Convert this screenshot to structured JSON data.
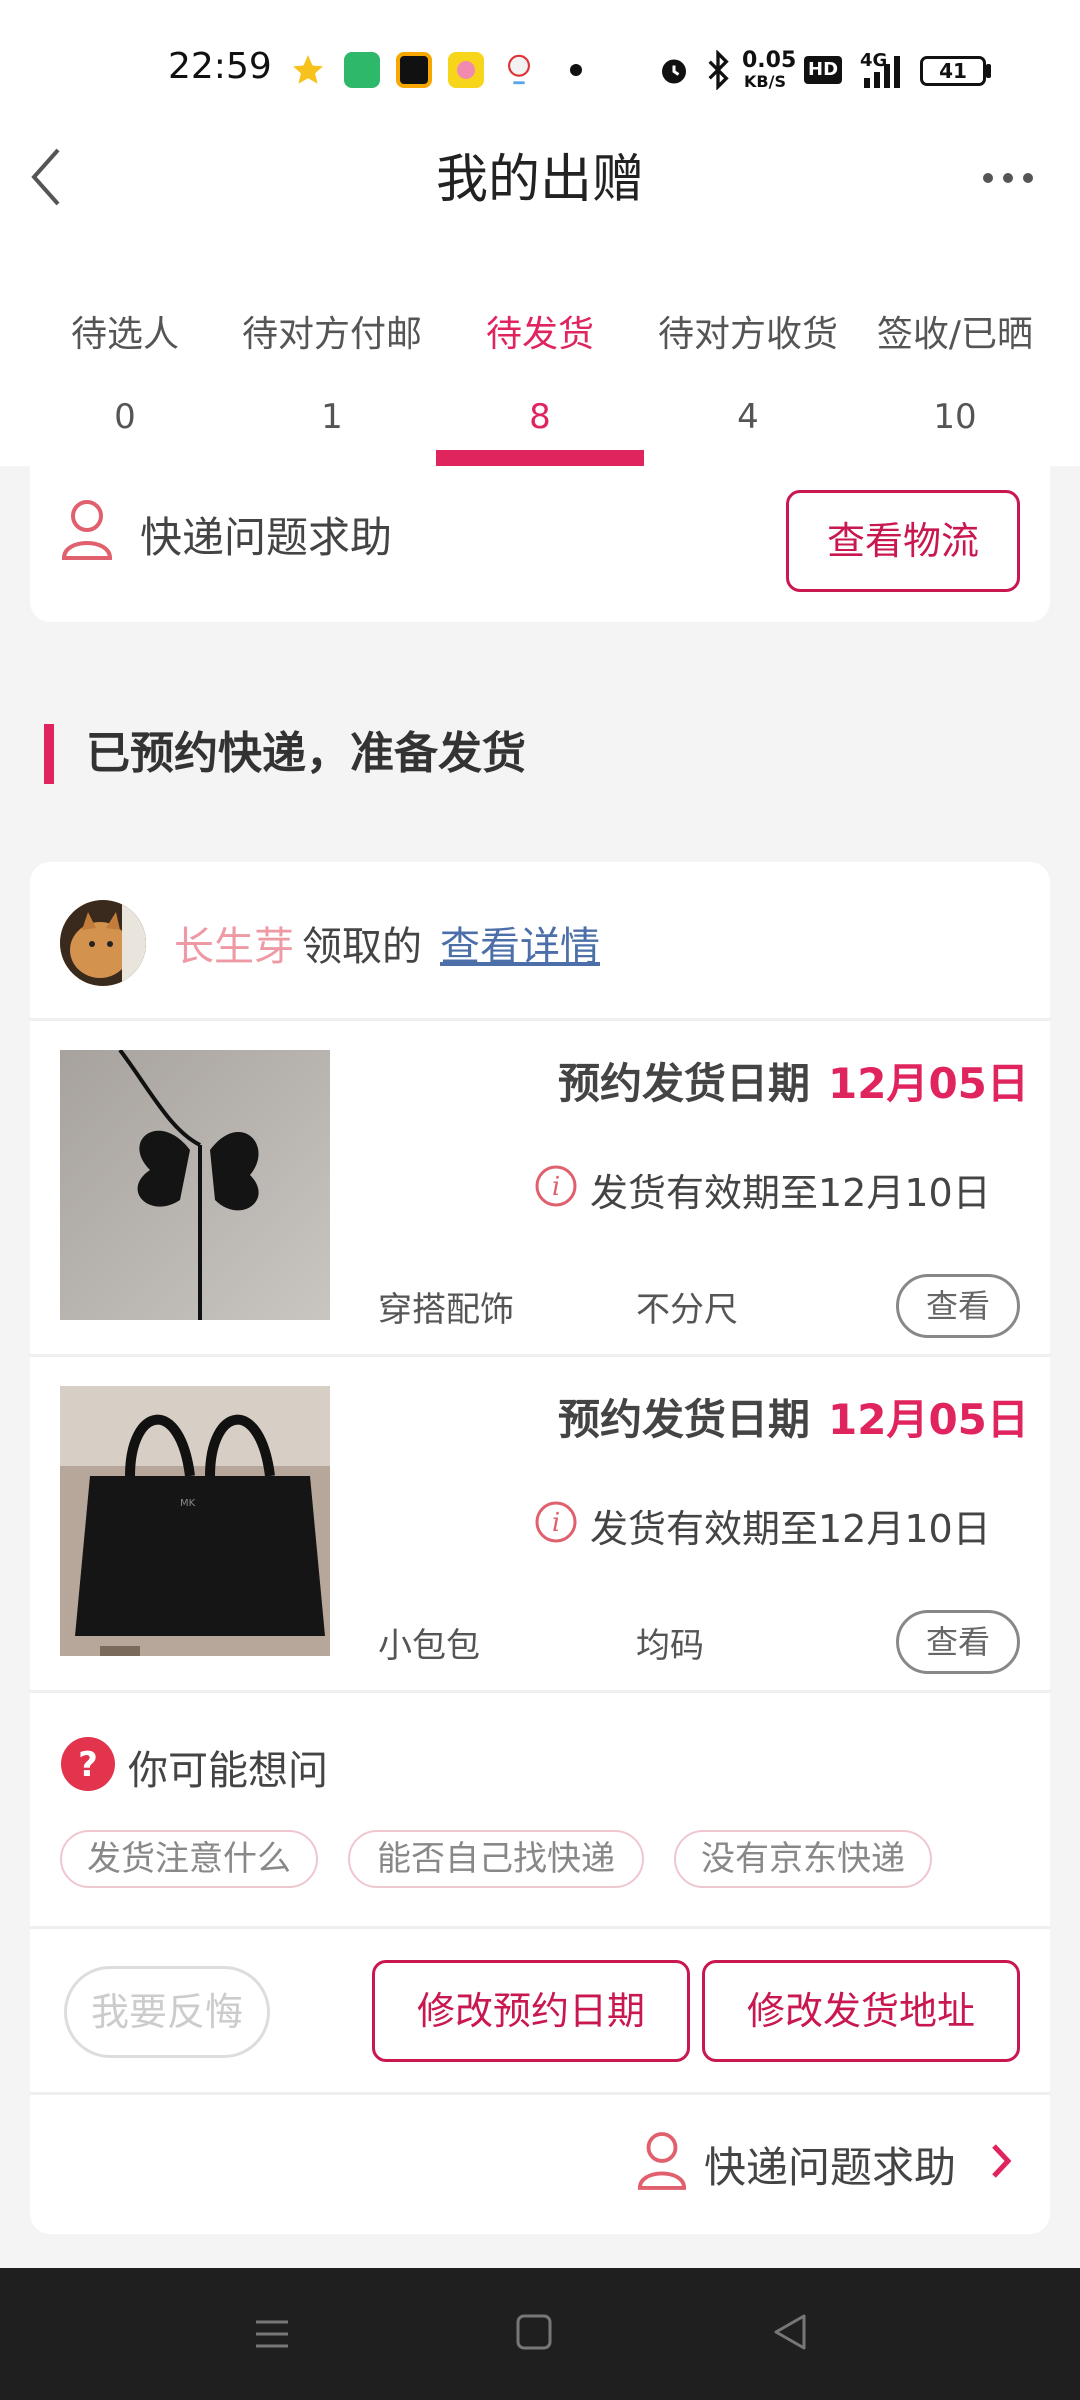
{
  "status_bar": {
    "time": "22:59",
    "net_speed_value": "0.05",
    "net_speed_unit": "KB/S",
    "hd_label": "HD",
    "signal_label": "4G",
    "battery": "41"
  },
  "header": {
    "title": "我的出赠"
  },
  "tabs": [
    {
      "label": "待选人",
      "count": "0"
    },
    {
      "label": "待对方付邮",
      "count": "1"
    },
    {
      "label": "待发货",
      "count": "8"
    },
    {
      "label": "待对方收货",
      "count": "4"
    },
    {
      "label": "签收/已晒",
      "count": "10"
    }
  ],
  "top_card": {
    "help_label": "快递问题求助",
    "logistics_button": "查看物流"
  },
  "section": {
    "title": "已预约快递，准备发货"
  },
  "order": {
    "receiver_name": "长生芽",
    "receiver_suffix": "领取的",
    "details_link": "查看详情",
    "items": [
      {
        "schedule_label": "预约发货日期",
        "schedule_date": "12月05日",
        "validity": "发货有效期至12月10日",
        "category": "穿搭配饰",
        "size": "不分尺",
        "view_label": "查看"
      },
      {
        "schedule_label": "预约发货日期",
        "schedule_date": "12月05日",
        "validity": "发货有效期至12月10日",
        "category": "小包包",
        "size": "均码",
        "view_label": "查看"
      }
    ],
    "faq": {
      "title": "你可能想问",
      "chips": [
        "发货注意什么",
        "能否自己找快递",
        "没有京东快递"
      ]
    },
    "actions": {
      "regret": "我要反悔",
      "change_date": "修改预约日期",
      "change_address": "修改发货地址"
    },
    "help_label": "快递问题求助"
  },
  "colors": {
    "accent": "#e0245e",
    "button_border": "#c9174f",
    "background": "#f4f4f4"
  }
}
